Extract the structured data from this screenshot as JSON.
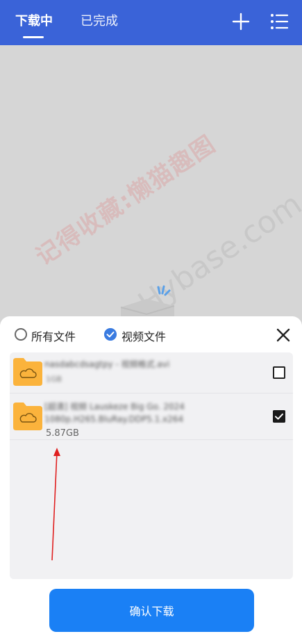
{
  "header": {
    "tabs": [
      {
        "label": "下载中",
        "active": true
      },
      {
        "label": "已完成",
        "active": false
      }
    ],
    "icons": [
      "plus-icon",
      "list-icon"
    ]
  },
  "watermark": {
    "cn": "记得收藏:懒猫趣图",
    "en": "Hybase.com"
  },
  "sheet": {
    "filters": [
      {
        "label": "所有文件",
        "selected": false
      },
      {
        "label": "视频文件",
        "selected": true
      }
    ],
    "files": [
      {
        "name": "nasdabcdsagtpy - 视频格式.avi",
        "size": "1GB",
        "checked": false
      },
      {
        "name": "[超清] 视频 Lauskeze Big Go. 2024 1080p.H265.BluRay.DDP5.1.x264",
        "size": "5.87GB",
        "checked": true
      }
    ],
    "confirm_label": "确认下载"
  },
  "colors": {
    "header_bg": "#3a63d8",
    "accent": "#1a80f5",
    "folder": "#fbb33c"
  }
}
